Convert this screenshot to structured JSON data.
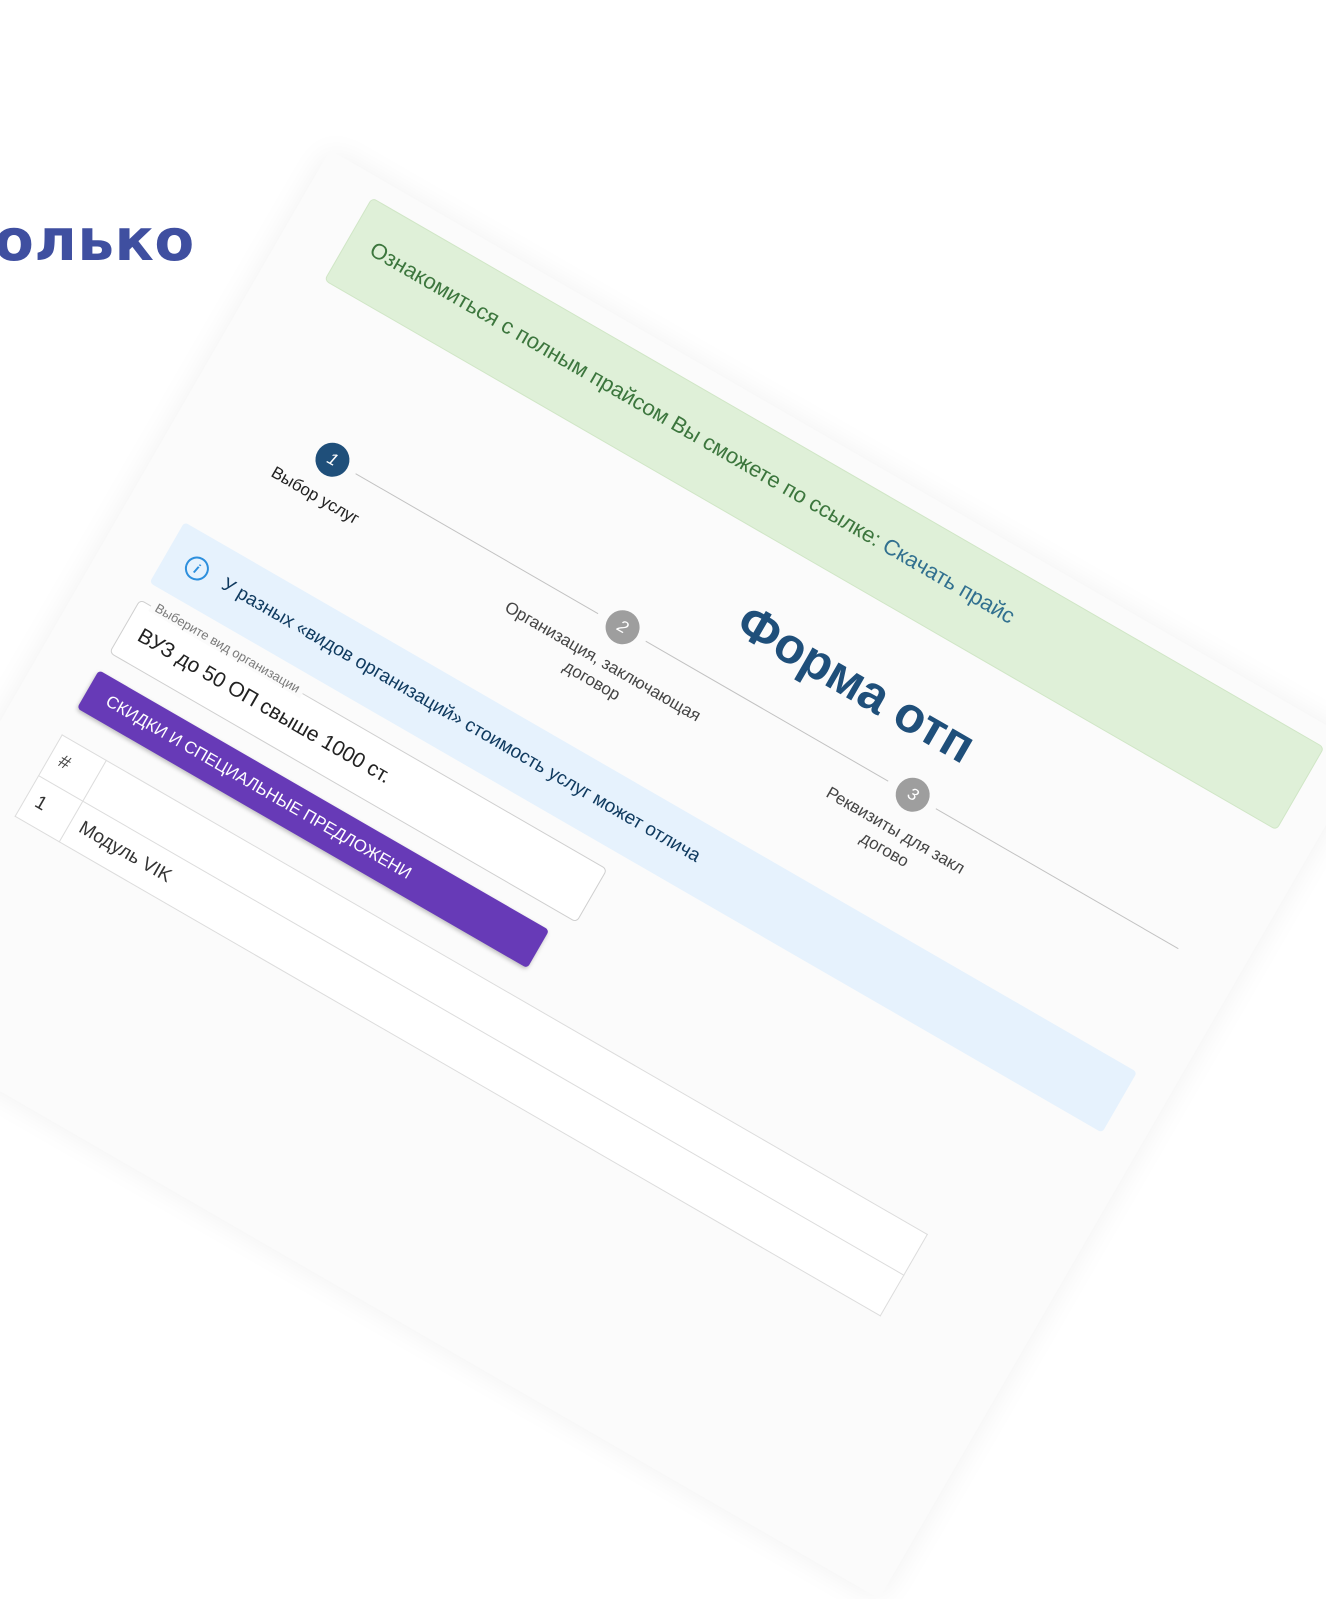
{
  "slide": {
    "heading": "олько"
  },
  "alert": {
    "text": "Ознакомиться с полным прайсом Вы сможете по ссылке: ",
    "link_text": "Скачать прайс"
  },
  "form": {
    "title": "Форма отп"
  },
  "stepper": {
    "steps": [
      {
        "number": "1",
        "label": "Выбор услуг",
        "active": true
      },
      {
        "number": "2",
        "label_line1": "Организация, заключающая",
        "label_line2": "договор",
        "active": false
      },
      {
        "number": "3",
        "label_line1": "Реквизиты для закл",
        "label_line2": "догово",
        "active": false
      }
    ]
  },
  "info": {
    "icon": "info-icon",
    "text": "У разных «видов организаций» стоимость услуг может отлича"
  },
  "org_select": {
    "legend": "Выберите вид организации",
    "value": "ВУЗ до 50 ОП свыше 1000 ст."
  },
  "promo": {
    "label": "СКИДКИ И СПЕЦИАЛЬНЫЕ ПРЕДЛОЖЕНИ"
  },
  "table": {
    "header": [
      "#",
      ""
    ],
    "rows": [
      {
        "index": "1",
        "name": "Модуль VIK"
      }
    ]
  },
  "colors": {
    "heading": "#3f4fa0",
    "alert_bg": "#dff0d8",
    "alert_text": "#3c763d",
    "link": "#31708f",
    "title": "#1f4f7a",
    "step_active": "#1f4f7a",
    "step_inactive": "#9e9e9e",
    "info_bg": "#e6f2fd",
    "promo": "#673ab7"
  }
}
